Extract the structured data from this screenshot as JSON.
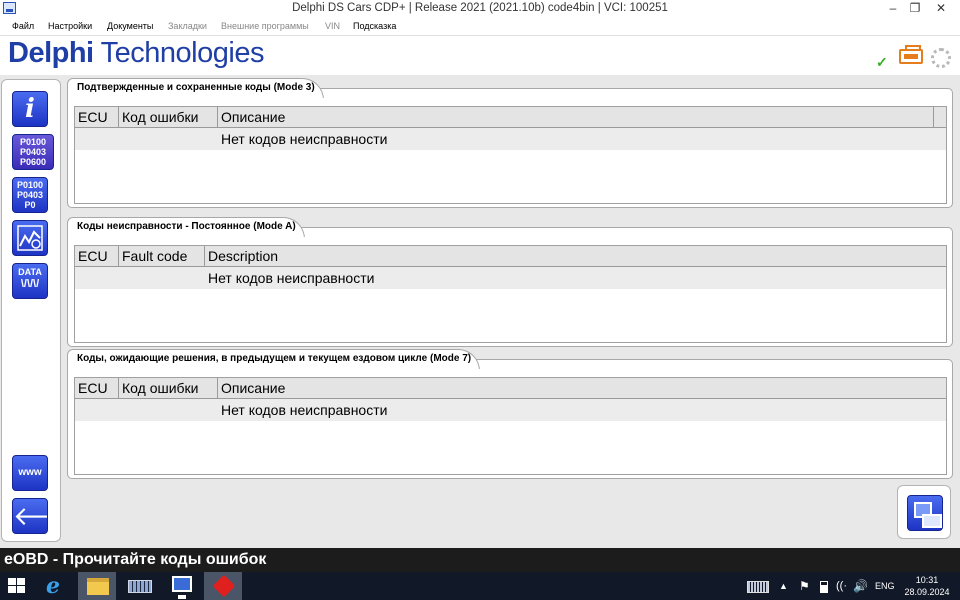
{
  "window": {
    "title": "Delphi DS Cars CDP+ | Release 2021 (2021.10b) code4bin  |  VCI: 100251",
    "minimize": "–",
    "maximize": "❐",
    "close": "✕"
  },
  "menu": [
    {
      "label": "Файл",
      "enabled": true
    },
    {
      "label": "Настройки",
      "enabled": true
    },
    {
      "label": "Документы",
      "enabled": true
    },
    {
      "label": "Закладки",
      "enabled": false
    },
    {
      "label": "Внешние программы",
      "enabled": false
    },
    {
      "label": "VIN",
      "enabled": false
    },
    {
      "label": "Подсказка",
      "enabled": true
    }
  ],
  "header": {
    "logo_bold": "Delphi",
    "logo_rest": " Technologies",
    "status_check": "✓"
  },
  "sidebar": {
    "info": "i",
    "codes_read": [
      "P0100",
      "P0403",
      "P0600"
    ],
    "codes_clear": [
      "P0100",
      "P0403",
      "P0"
    ],
    "data": "DATA",
    "data_wave": "\\/\\/\\/",
    "www": "www",
    "back": "🡐"
  },
  "panels": [
    {
      "title": "Подтвержденные и сохраненные коды (Mode 3)",
      "columns": [
        "ECU",
        "Код ошибки",
        "Описание"
      ],
      "message": "Нет кодов неисправности"
    },
    {
      "title": "Коды неисправности - Постоянное (Mode A)",
      "columns": [
        "ECU",
        "Fault code",
        "Description"
      ],
      "message": "Нет кодов неисправности"
    },
    {
      "title": "Коды, ожидающие решения, в предыдущем и текущем ездовом цикле (Mode 7)",
      "columns": [
        "ECU",
        "Код ошибки",
        "Описание"
      ],
      "message": "Нет кодов неисправности"
    }
  ],
  "status": "eOBD - Прочитайте коды ошибок",
  "taskbar": {
    "ie": "e",
    "up_arrow": "▲",
    "flag": "⚑",
    "wifi": "((·",
    "volume": "🔊",
    "lang": "ENG",
    "time": "10:31",
    "date": "28.09.2024"
  },
  "colors": {
    "brand": "#1f3fa6",
    "accent": "#e67d1d",
    "ok": "#34b024",
    "button": "#2a44d8"
  }
}
